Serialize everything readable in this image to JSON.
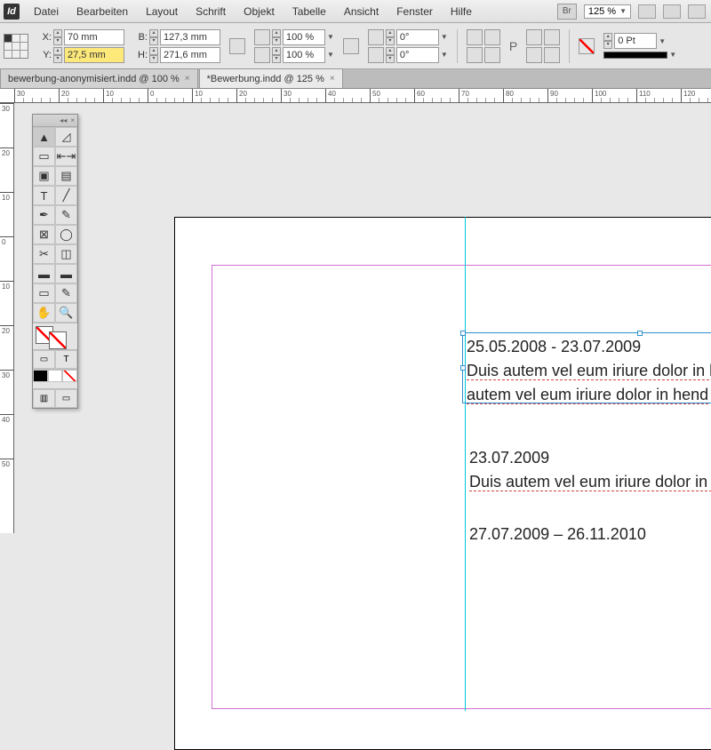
{
  "app": {
    "icon": "Id"
  },
  "menu": [
    "Datei",
    "Bearbeiten",
    "Layout",
    "Schrift",
    "Objekt",
    "Tabelle",
    "Ansicht",
    "Fenster",
    "Hilfe"
  ],
  "menubar_right": {
    "bridge": "Br",
    "zoom": "125 %"
  },
  "control": {
    "X": "70 mm",
    "Y": "27,5 mm",
    "B": "127,3 mm",
    "H": "271,6 mm",
    "scaleX": "100 %",
    "scaleY": "100 %",
    "rotate": "0°",
    "shear": "0°",
    "stroke": "0 Pt"
  },
  "tabs": [
    {
      "label": "bewerbung-anonymisiert.indd @ 100 %",
      "active": false
    },
    {
      "label": "*Bewerbung.indd @ 125 %",
      "active": true
    }
  ],
  "ruler_h": [
    30,
    20,
    10,
    0,
    10,
    20,
    30,
    40,
    50,
    60,
    70,
    80,
    90,
    100,
    110,
    120
  ],
  "ruler_v": [
    30,
    20,
    10,
    0,
    10,
    20,
    30,
    40,
    50
  ],
  "frame": {
    "line1": "25.05.2008 - 23.07.2009",
    "line2": "Duis autem vel eum iriure dolor in h",
    "line3": "autem vel eum iriure dolor in hend",
    "line4": "23.07.2009",
    "line5": "Duis autem vel eum iriure dolor in h",
    "line6": "27.07.2009 – 26.11.2010"
  },
  "tools": [
    "➤",
    "⬀",
    "⬚",
    "⇤⇥",
    "✂",
    "⬚",
    "T",
    "／",
    "✒",
    "◢",
    "▭",
    "◯",
    "✂",
    "⧉",
    "▭",
    "▭",
    "▭",
    "✎",
    "✋",
    "🔍"
  ]
}
